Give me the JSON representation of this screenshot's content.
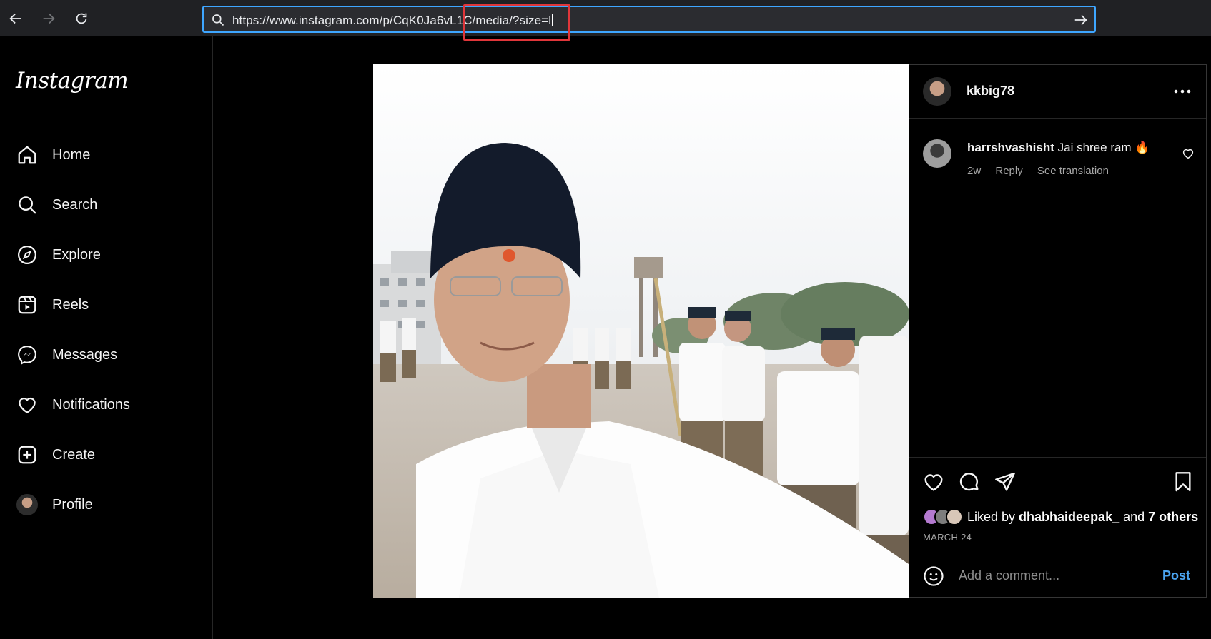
{
  "browser": {
    "url_text": "https://www.instagram.com/p/CqK0Ja6vL1C/media/?size=l"
  },
  "sidebar": {
    "logo": "Instagram",
    "items": [
      {
        "label": "Home",
        "icon": "home-icon"
      },
      {
        "label": "Search",
        "icon": "search-icon"
      },
      {
        "label": "Explore",
        "icon": "compass-icon"
      },
      {
        "label": "Reels",
        "icon": "reels-icon"
      },
      {
        "label": "Messages",
        "icon": "messenger-icon"
      },
      {
        "label": "Notifications",
        "icon": "heart-icon"
      },
      {
        "label": "Create",
        "icon": "plus-square-icon"
      },
      {
        "label": "Profile",
        "icon": "avatar"
      }
    ]
  },
  "post": {
    "author": "kkbig78",
    "comment": {
      "user": "harrshvashisht",
      "text": " Jai shree ram ",
      "emoji": "🔥",
      "age": "2w",
      "reply": "Reply",
      "translate": "See translation"
    },
    "likes": {
      "prefix": "Liked by",
      "user": "dhabhaideepak_",
      "and": "and",
      "others": "7 others"
    },
    "date": "MARCH 24",
    "comment_placeholder": "Add a comment...",
    "post_button": "Post"
  },
  "colors": {
    "accent": "#4aa3ef",
    "highlight_box": "#e0363a",
    "address_border": "#3ea6ff"
  }
}
